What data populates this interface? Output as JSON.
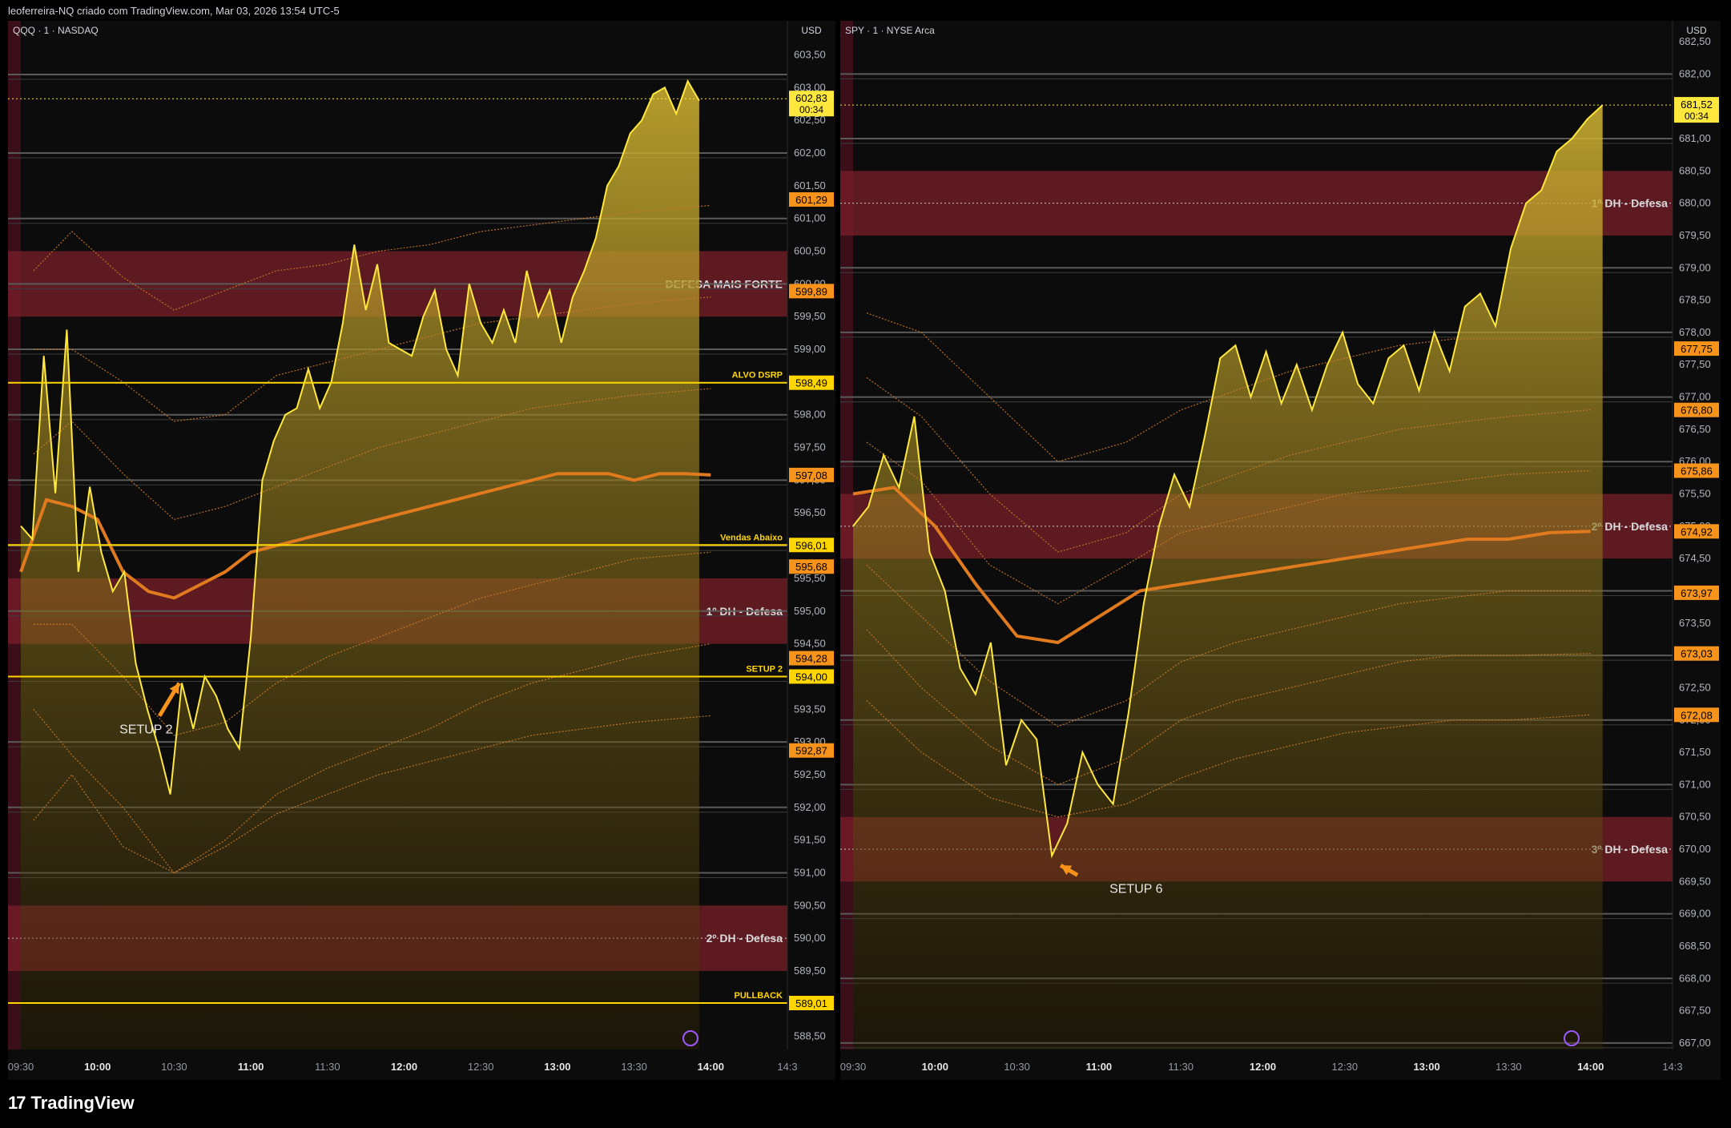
{
  "header": {
    "text": "leoferreira-NQ criado com TradingView.com, Mar 03, 2026 13:54 UTC-5"
  },
  "footer": {
    "brand": "TradingView"
  },
  "colors": {
    "background": "#000000",
    "panel": "#0c0c0c",
    "price_line": "#ffe83d",
    "vwap": "#e07a1f",
    "band": "#c87a2a",
    "zone": "#7a1f28",
    "label_orange": "#f7931a",
    "label_yellow": "#ffd600"
  },
  "chart_data": [
    {
      "type": "line",
      "symbol": "QQQ · 1 · NASDAQ",
      "currency": "USD",
      "ylim": [
        588.3,
        603.8
      ],
      "yticks": [
        "603,50",
        "603,00",
        "602,50",
        "602,00",
        "601,50",
        "601,00",
        "600,50",
        "600,00",
        "599,50",
        "599,00",
        "598,50",
        "598,00",
        "597,50",
        "597,00",
        "596,50",
        "596,00",
        "595,50",
        "595,00",
        "594,50",
        "594,00",
        "593,50",
        "593,00",
        "592,50",
        "592,00",
        "591,50",
        "591,00",
        "590,50",
        "590,00",
        "589,50",
        "589,00",
        "588,50"
      ],
      "ytick_values": [
        603.5,
        603.0,
        602.5,
        602.0,
        601.5,
        601.0,
        600.5,
        600.0,
        599.5,
        599.0,
        598.5,
        598.0,
        597.5,
        597.0,
        596.5,
        596.0,
        595.5,
        595.0,
        594.5,
        594.0,
        593.5,
        593.0,
        592.5,
        592.0,
        591.5,
        591.0,
        590.5,
        590.0,
        589.5,
        589.0,
        588.5
      ],
      "xticks": [
        "09:30",
        "10:00",
        "10:30",
        "11:00",
        "11:30",
        "12:00",
        "12:30",
        "13:00",
        "13:30",
        "14:00",
        "14:3"
      ],
      "xtick_bold": [
        false,
        true,
        false,
        true,
        false,
        true,
        false,
        true,
        false,
        true,
        false
      ],
      "x_range_min": [
        0,
        300
      ],
      "x": [
        0,
        3,
        6,
        9,
        12,
        15,
        18,
        21,
        24,
        27,
        30,
        33,
        36,
        39,
        42,
        45,
        48,
        51,
        54,
        57,
        60,
        63,
        66,
        69,
        72,
        75,
        78,
        81,
        84,
        87,
        90,
        93,
        96,
        99,
        102,
        105,
        108,
        111,
        114,
        117,
        120,
        123,
        126,
        129,
        132,
        135,
        138,
        141,
        144,
        147,
        150,
        153,
        156,
        159,
        162,
        165,
        168,
        171,
        174,
        177,
        180,
        183,
        186,
        189,
        192,
        195,
        198,
        201,
        204,
        207,
        210,
        213,
        216,
        219,
        222,
        225,
        228,
        231,
        234,
        237,
        240,
        243,
        246,
        249,
        252,
        255,
        258,
        261,
        264,
        267,
        270
      ],
      "price": [
        596.3,
        596.1,
        598.9,
        596.8,
        599.3,
        595.6,
        596.9,
        595.9,
        595.3,
        595.6,
        594.2,
        593.5,
        592.9,
        592.2,
        593.9,
        593.2,
        594.0,
        593.7,
        593.2,
        592.9,
        594.6,
        597.0,
        597.6,
        598.0,
        598.1,
        598.7,
        598.1,
        598.5,
        599.4,
        600.6,
        599.6,
        600.3,
        599.1,
        599.0,
        598.9,
        599.5,
        599.9,
        599.0,
        598.6,
        600.0,
        599.4,
        599.1,
        599.6,
        599.1,
        600.2,
        599.5,
        599.9,
        599.1,
        599.8,
        600.2,
        600.7,
        601.5,
        601.8,
        602.3,
        602.5,
        602.9,
        603.0,
        602.6,
        603.1,
        602.8
      ],
      "price_step": 4.5,
      "vwap": {
        "x": [
          0,
          10,
          20,
          30,
          40,
          50,
          60,
          70,
          80,
          90,
          100,
          110,
          120,
          130,
          140,
          150,
          160,
          170,
          180,
          190,
          200,
          210,
          220,
          230,
          240,
          250,
          260,
          270
        ],
        "y": [
          595.6,
          596.7,
          596.6,
          596.4,
          595.6,
          595.3,
          595.2,
          595.4,
          595.6,
          595.9,
          596.0,
          596.1,
          596.2,
          596.3,
          596.4,
          596.5,
          596.6,
          596.7,
          596.8,
          596.9,
          597.0,
          597.1,
          597.1,
          597.1,
          597.0,
          597.1,
          597.1,
          597.08
        ]
      },
      "bands": [
        {
          "x": [
            5,
            20,
            40,
            60,
            80,
            100,
            120,
            140,
            160,
            180,
            200,
            220,
            240,
            270
          ],
          "y": [
            600.2,
            600.8,
            600.1,
            599.6,
            599.9,
            600.2,
            600.3,
            600.5,
            600.6,
            600.8,
            600.9,
            601.0,
            601.1,
            601.2
          ]
        },
        {
          "x": [
            5,
            20,
            40,
            60,
            80,
            100,
            120,
            140,
            160,
            180,
            200,
            220,
            240,
            270
          ],
          "y": [
            599.0,
            599.0,
            598.5,
            597.9,
            598.0,
            598.6,
            598.8,
            599.0,
            599.2,
            599.4,
            599.5,
            599.6,
            599.7,
            599.8
          ]
        },
        {
          "x": [
            5,
            20,
            40,
            60,
            80,
            100,
            120,
            140,
            160,
            180,
            200,
            220,
            240,
            270
          ],
          "y": [
            597.4,
            597.9,
            597.1,
            596.4,
            596.6,
            596.9,
            597.2,
            597.5,
            597.7,
            597.9,
            598.1,
            598.2,
            598.3,
            598.4
          ]
        },
        {
          "x": [
            5,
            20,
            40,
            60,
            80,
            100,
            120,
            140,
            160,
            180,
            200,
            220,
            240,
            270
          ],
          "y": [
            594.8,
            594.8,
            594.0,
            593.1,
            593.3,
            593.9,
            594.3,
            594.6,
            594.9,
            595.2,
            595.4,
            595.6,
            595.8,
            595.9
          ]
        },
        {
          "x": [
            5,
            20,
            40,
            60,
            80,
            100,
            120,
            140,
            160,
            180,
            200,
            220,
            240,
            270
          ],
          "y": [
            593.5,
            592.8,
            592.0,
            591.0,
            591.5,
            592.2,
            592.6,
            592.9,
            593.2,
            593.6,
            593.9,
            594.1,
            594.3,
            594.5
          ]
        },
        {
          "x": [
            5,
            20,
            40,
            60,
            80,
            100,
            120,
            140,
            160,
            180,
            200,
            220,
            240,
            270
          ],
          "y": [
            591.8,
            592.5,
            591.4,
            591.0,
            591.4,
            591.9,
            592.2,
            592.5,
            592.7,
            592.9,
            593.1,
            593.2,
            593.3,
            593.4
          ]
        }
      ],
      "zones": [
        {
          "from": 599.5,
          "to": 600.5,
          "label": "DEFESA MAIS FORTE",
          "mid": 600.0
        },
        {
          "from": 594.5,
          "to": 595.5,
          "label": "1º DH - Defesa",
          "mid": 595.0
        },
        {
          "from": 589.5,
          "to": 590.5,
          "label": "2º DH - Defesa",
          "mid": 590.0
        }
      ],
      "hlines_gray": [
        603.2,
        602.0,
        601.0,
        600.0,
        599.0,
        598.0,
        597.0,
        596.0,
        595.0,
        594.0,
        593.0,
        592.0,
        591.0
      ],
      "lines": [
        {
          "value": 598.49,
          "label": "ALVO DSRP",
          "price_label": "598,49"
        },
        {
          "value": 596.01,
          "label": "Vendas Abaixo",
          "price_label": "596,01"
        },
        {
          "value": 594.0,
          "label": "SETUP 2",
          "price_label": "594,00"
        },
        {
          "value": 589.01,
          "label": "PULLBACK",
          "price_label": "589,01"
        }
      ],
      "orange_tags": [
        {
          "value": 601.29,
          "text": "601,29"
        },
        {
          "value": 599.89,
          "text": "599,89"
        },
        {
          "value": 597.08,
          "text": "597,08"
        },
        {
          "value": 595.68,
          "text": "595,68"
        },
        {
          "value": 594.28,
          "text": "594,28"
        },
        {
          "value": 592.87,
          "text": "592,87"
        }
      ],
      "last_price": {
        "value": 602.83,
        "text": "602,83",
        "countdown": "00:34"
      },
      "annotation": {
        "text": "SETUP 2",
        "x": 48,
        "y": 593.3,
        "arrow_to_x": 62,
        "arrow_to_y": 593.9
      }
    },
    {
      "type": "line",
      "symbol": "SPY · 1 · NYSE Arca",
      "currency": "USD",
      "ylim": [
        666.9,
        682.6
      ],
      "yticks": [
        "682,50",
        "682,00",
        "681,50",
        "681,00",
        "680,50",
        "680,00",
        "679,50",
        "679,00",
        "678,50",
        "678,00",
        "677,50",
        "677,00",
        "676,50",
        "676,00",
        "675,50",
        "675,00",
        "674,50",
        "674,00",
        "673,50",
        "673,00",
        "672,50",
        "672,00",
        "671,50",
        "671,00",
        "670,50",
        "670,00",
        "669,50",
        "669,00",
        "668,50",
        "668,00",
        "667,50",
        "667,00"
      ],
      "ytick_values": [
        682.5,
        682.0,
        681.5,
        681.0,
        680.5,
        680.0,
        679.5,
        679.0,
        678.5,
        678.0,
        677.5,
        677.0,
        676.5,
        676.0,
        675.5,
        675.0,
        674.5,
        674.0,
        673.5,
        673.0,
        672.5,
        672.0,
        671.5,
        671.0,
        670.5,
        670.0,
        669.5,
        669.0,
        668.5,
        668.0,
        667.5,
        667.0
      ],
      "xticks": [
        "09:30",
        "10:00",
        "10:30",
        "11:00",
        "11:30",
        "12:00",
        "12:30",
        "13:00",
        "13:30",
        "14:00",
        "14:3"
      ],
      "xtick_bold": [
        false,
        true,
        false,
        true,
        false,
        true,
        false,
        true,
        false,
        true,
        false
      ],
      "x_range_min": [
        0,
        300
      ],
      "x": [
        0,
        3,
        6,
        9,
        12,
        15,
        18,
        21,
        24,
        27,
        30,
        33,
        36,
        39,
        42,
        45,
        48,
        51,
        54,
        57,
        60,
        63,
        66,
        69,
        72,
        75,
        78,
        81,
        84,
        87,
        90,
        93,
        96,
        99,
        102,
        105,
        108,
        111,
        114,
        117,
        120,
        123,
        126,
        129,
        132,
        135,
        138,
        141,
        144,
        147,
        150,
        153,
        156,
        159,
        162,
        165,
        168,
        171,
        174,
        177,
        180,
        183,
        186,
        189,
        192,
        195,
        198,
        201,
        204,
        207,
        210,
        213,
        216,
        219,
        222,
        225,
        228,
        231,
        234,
        237,
        240,
        243,
        246,
        249,
        252,
        255,
        258,
        261,
        264,
        267,
        270
      ],
      "price": [
        675.0,
        675.3,
        676.1,
        675.6,
        676.7,
        674.6,
        674.0,
        672.8,
        672.4,
        673.2,
        671.3,
        672.0,
        671.7,
        669.9,
        670.4,
        671.5,
        671.0,
        670.7,
        672.1,
        673.8,
        675.0,
        675.8,
        675.3,
        676.4,
        677.6,
        677.8,
        677.0,
        677.7,
        676.9,
        677.5,
        676.8,
        677.5,
        678.0,
        677.2,
        676.9,
        677.6,
        677.8,
        677.1,
        678.0,
        677.4,
        678.4,
        678.6,
        678.1,
        679.3,
        680.0,
        680.2,
        680.8,
        681.0,
        681.3,
        681.52
      ],
      "price_step": 5.6,
      "vwap": {
        "x": [
          0,
          15,
          30,
          45,
          60,
          75,
          90,
          105,
          120,
          135,
          150,
          165,
          180,
          195,
          210,
          225,
          240,
          255,
          270
        ],
        "y": [
          675.5,
          675.6,
          675.0,
          674.1,
          673.3,
          673.2,
          673.6,
          674.0,
          674.1,
          674.2,
          674.3,
          674.4,
          674.5,
          674.6,
          674.7,
          674.8,
          674.8,
          674.9,
          674.92
        ]
      },
      "bands": [
        {
          "x": [
            5,
            25,
            50,
            75,
            100,
            120,
            140,
            160,
            180,
            200,
            220,
            240,
            270
          ],
          "y": [
            678.3,
            678.0,
            677.0,
            676.0,
            676.3,
            676.8,
            677.1,
            677.4,
            677.6,
            677.8,
            677.9,
            677.9,
            677.9
          ]
        },
        {
          "x": [
            5,
            25,
            50,
            75,
            100,
            120,
            140,
            160,
            180,
            200,
            220,
            240,
            270
          ],
          "y": [
            677.3,
            676.7,
            675.5,
            674.6,
            674.9,
            675.5,
            675.8,
            676.1,
            676.3,
            676.5,
            676.6,
            676.7,
            676.8
          ]
        },
        {
          "x": [
            5,
            25,
            50,
            75,
            100,
            120,
            140,
            160,
            180,
            200,
            220,
            240,
            270
          ],
          "y": [
            676.3,
            675.7,
            674.4,
            673.8,
            674.4,
            674.9,
            675.1,
            675.3,
            675.5,
            675.6,
            675.7,
            675.8,
            675.86
          ]
        },
        {
          "x": [
            5,
            25,
            50,
            75,
            100,
            120,
            140,
            160,
            180,
            200,
            220,
            240,
            270
          ],
          "y": [
            674.4,
            673.6,
            672.6,
            671.9,
            672.3,
            672.9,
            673.2,
            673.4,
            673.6,
            673.8,
            673.9,
            674.0,
            674.0
          ]
        },
        {
          "x": [
            5,
            25,
            50,
            75,
            100,
            120,
            140,
            160,
            180,
            200,
            220,
            240,
            270
          ],
          "y": [
            673.4,
            672.5,
            671.6,
            671.0,
            671.4,
            672.0,
            672.3,
            672.5,
            672.7,
            672.9,
            673.0,
            673.0,
            673.03
          ]
        },
        {
          "x": [
            5,
            25,
            50,
            75,
            100,
            120,
            140,
            160,
            180,
            200,
            220,
            240,
            270
          ],
          "y": [
            672.3,
            671.5,
            670.8,
            670.5,
            670.7,
            671.1,
            671.4,
            671.6,
            671.8,
            671.9,
            672.0,
            672.0,
            672.08
          ]
        }
      ],
      "zones": [
        {
          "from": 679.5,
          "to": 680.5,
          "label": "1º DH - Defesa",
          "mid": 680.0
        },
        {
          "from": 674.5,
          "to": 675.5,
          "label": "2º DH - Defesa",
          "mid": 675.0
        },
        {
          "from": 669.5,
          "to": 670.5,
          "label": "3º DH - Defesa",
          "mid": 670.0
        }
      ],
      "hlines_gray": [
        682.0,
        681.0,
        679.0,
        678.0,
        677.0,
        676.0,
        674.0,
        673.0,
        672.0,
        671.0,
        669.0,
        668.0,
        667.0
      ],
      "lines": [],
      "orange_tags": [
        {
          "value": 677.75,
          "text": "677,75"
        },
        {
          "value": 676.8,
          "text": "676,80"
        },
        {
          "value": 675.86,
          "text": "675,86"
        },
        {
          "value": 674.92,
          "text": "674,92"
        },
        {
          "value": 673.97,
          "text": "673,97"
        },
        {
          "value": 673.03,
          "text": "673,03"
        },
        {
          "value": 672.08,
          "text": "672,08"
        }
      ],
      "last_price": {
        "value": 681.52,
        "text": "681,52",
        "countdown": "00:34"
      },
      "annotation": {
        "text": "SETUP 6",
        "x": 88,
        "y": 669.5,
        "arrow_to_x": 76,
        "arrow_to_y": 669.75
      }
    }
  ]
}
